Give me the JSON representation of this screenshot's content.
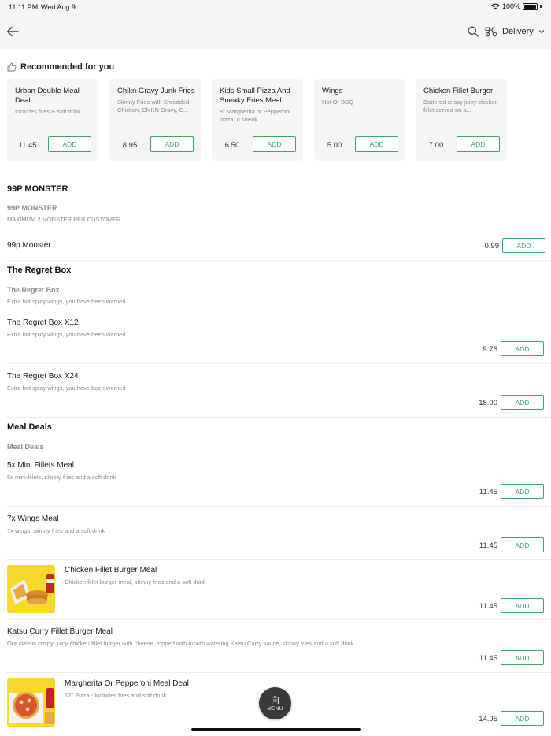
{
  "status_bar": {
    "time": "11:11 PM",
    "date": "Wed Aug 9",
    "battery": "100%"
  },
  "header": {
    "delivery_label": "Delivery"
  },
  "recommended": {
    "title": "Recommended for you",
    "items": [
      {
        "name": "Urban Double Meal Deal",
        "desc": "Includes fries & soft drink",
        "price": "11.45",
        "add": "ADD"
      },
      {
        "name": "Chikn Gravy Junk Fries",
        "desc": "Skinny Fries with Shredded Chicken, ChiKN Gravy, C...",
        "price": "8.95",
        "add": "ADD"
      },
      {
        "name": "Kids Small Pizza And Sneaky Fries Meal",
        "desc": "8\" Margherita or Pepperoni pizza, a sneak...",
        "price": "6.50",
        "add": "ADD"
      },
      {
        "name": "Wings",
        "desc": "Hot Or BBQ",
        "price": "5.00",
        "add": "ADD"
      },
      {
        "name": "Chicken Fillet Burger",
        "desc": "Battered crispy juicy chicken fillet served on a...",
        "price": "7.00",
        "add": "ADD"
      }
    ]
  },
  "sections": {
    "monster": {
      "title": "99P MONSTER",
      "subcat_title": "99P MONSTER",
      "subcat_desc": "MAXIMUM 2 MONSTER PER CUSTOMER",
      "items": [
        {
          "name": "99p Monster",
          "price": "0.99",
          "add": "ADD"
        }
      ]
    },
    "regret": {
      "title": "The Regret Box",
      "subcat_title": "The Regret Box",
      "subcat_desc": "Extra hot spicy wings, you have been warned",
      "items": [
        {
          "name": "The Regret Box X12",
          "desc": "Extra hot spicy wings, you have been warned",
          "price": "9.75",
          "add": "ADD"
        },
        {
          "name": "The Regret Box X24",
          "desc": "Extra hot spicy wings, you have been warned",
          "price": "18.00",
          "add": "ADD"
        }
      ]
    },
    "meal_deals": {
      "title": "Meal Deals",
      "subcat_title": "Meal Deals",
      "items": [
        {
          "name": "5x Mini Fillets Meal",
          "desc": "5x mini-fillets, skinny fries and a soft drink",
          "price": "11.45",
          "add": "ADD"
        },
        {
          "name": "7x Wings Meal",
          "desc": "7x wings, skinny fries and a soft drink",
          "price": "11.45",
          "add": "ADD"
        },
        {
          "name": "Chicken Fillet Burger Meal",
          "desc": "Chicken fillet burger meal, skinny fries and a soft drink",
          "price": "11.45",
          "add": "ADD"
        },
        {
          "name": "Katsu Curry Fillet Burger Meal",
          "desc": "Our classic crispy, juicy chicken fillet burger with cheese, topped with mouth watering Katsu Curry sauce, skinny fries and a soft drink",
          "price": "11.45",
          "add": "ADD"
        },
        {
          "name": "Margherita Or Pepperoni Meal Deal",
          "desc": "12\" Pizza - Includes fries and soft drink",
          "price": "14.95",
          "add": "ADD"
        }
      ]
    }
  },
  "fab": {
    "label": "MENU"
  },
  "colors": {
    "accent": "#3ea56a",
    "header_bg": "#f5f5f5",
    "fab_bg": "#3a3a3a"
  },
  "icons": [
    "back-arrow-icon",
    "search-icon",
    "delivery-scooter-icon",
    "chevron-down-icon",
    "thumbs-up-icon",
    "menu-clipboard-icon",
    "wifi-icon",
    "battery-icon"
  ]
}
